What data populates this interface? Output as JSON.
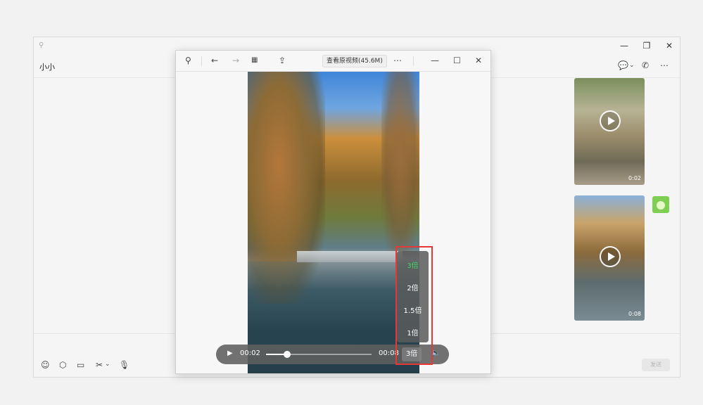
{
  "chat": {
    "title": "小小",
    "titlebar_icons": {
      "pin": "pin-icon",
      "min": "minimize-icon",
      "max": "maximize-icon",
      "close": "close-icon"
    },
    "tools": [
      "chat-bubble-icon",
      "chevron-down-icon",
      "call-icon",
      "more-icon"
    ],
    "input_tools": [
      "emoji-icon",
      "cube-icon",
      "folder-icon",
      "scissors-icon",
      "mic-icon"
    ],
    "send_label": "发送",
    "thumbnails": [
      {
        "duration": "0:02"
      },
      {
        "duration": "0:08"
      }
    ]
  },
  "viewer": {
    "toolbar": {
      "original_button": "查看原视频(45.6M)",
      "icons": [
        "pin-icon",
        "arrow-left-icon",
        "arrow-right-icon",
        "grid-icon",
        "export-icon",
        "more-icon",
        "minimize-icon",
        "maximize-icon",
        "close-icon"
      ]
    },
    "player": {
      "current_time": "00:02",
      "total_time": "00:08",
      "progress": 0.2,
      "speed_label": "3倍",
      "speed_options": [
        {
          "label": "3倍",
          "active": true
        },
        {
          "label": "2倍",
          "active": false
        },
        {
          "label": "1.5倍",
          "active": false
        },
        {
          "label": "1倍",
          "active": false
        }
      ]
    }
  },
  "colors": {
    "accent_green": "#3fd86b",
    "highlight_red": "#e53935"
  }
}
